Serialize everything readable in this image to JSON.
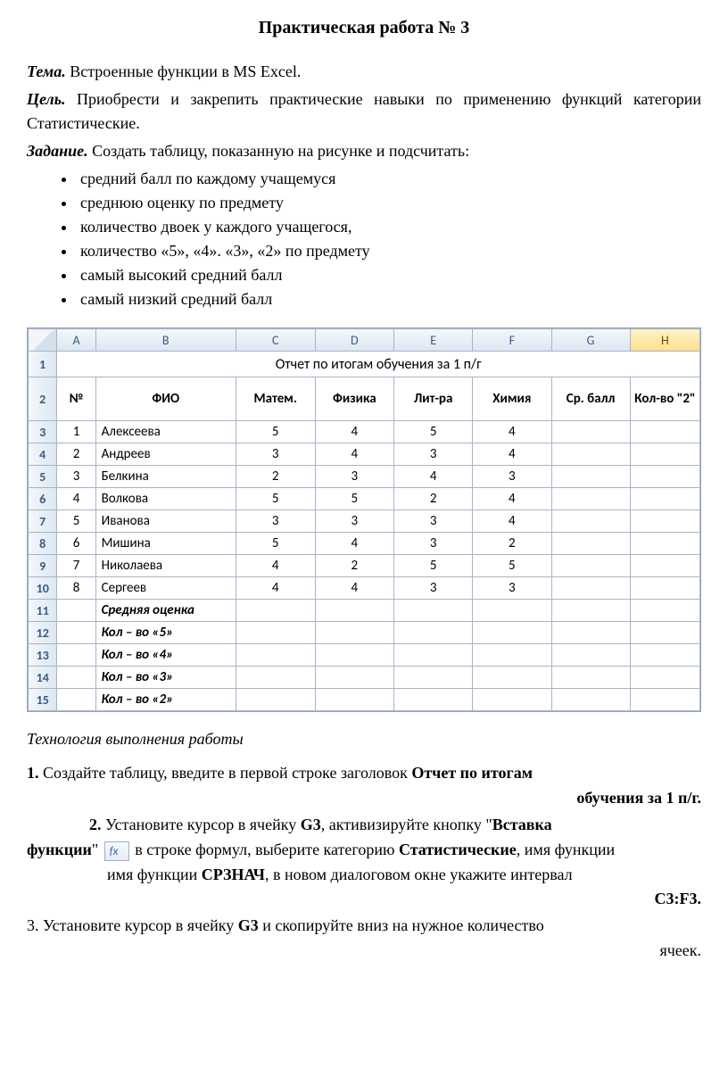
{
  "title": "Практическая работа № 3",
  "topic_label": "Тема.",
  "topic_text": "Встроенные функции в MS Excel.",
  "goal_label": "Цель.",
  "goal_text": "Приобрести и закрепить практические навыки по применению функций категории Статистические.",
  "task_label": "Задание.",
  "task_text": "Создать таблицу, показанную на рисунке и подсчитать:",
  "bullets": [
    "средний балл по каждому учащемуся",
    "среднюю оценку по предмету",
    "количество двоек у каждого учащегося,",
    "количество «5», «4». «3», «2» по предмету",
    "самый высокий средний балл",
    "самый низкий средний балл"
  ],
  "excel": {
    "columns": [
      "A",
      "B",
      "C",
      "D",
      "E",
      "F",
      "G",
      "H"
    ],
    "selected_col": "H",
    "row_numbers": [
      "1",
      "2",
      "3",
      "4",
      "5",
      "6",
      "7",
      "8",
      "9",
      "10",
      "11",
      "12",
      "13",
      "14",
      "15"
    ],
    "merged_title": "Отчет по итогам обучения за 1 п/г",
    "headers": [
      "№",
      "ФИО",
      "Матем.",
      "Физика",
      "Лит-ра",
      "Химия",
      "Ср. балл",
      "Кол-во \"2\""
    ],
    "rows": [
      {
        "n": "1",
        "name": "Алексеева",
        "m": "5",
        "p": "4",
        "l": "5",
        "c": "4"
      },
      {
        "n": "2",
        "name": "Андреев",
        "m": "3",
        "p": "4",
        "l": "3",
        "c": "4"
      },
      {
        "n": "3",
        "name": "Белкина",
        "m": "2",
        "p": "3",
        "l": "4",
        "c": "3"
      },
      {
        "n": "4",
        "name": "Волкова",
        "m": "5",
        "p": "5",
        "l": "2",
        "c": "4"
      },
      {
        "n": "5",
        "name": "Иванова",
        "m": "3",
        "p": "3",
        "l": "3",
        "c": "4"
      },
      {
        "n": "6",
        "name": "Мишина",
        "m": "5",
        "p": "4",
        "l": "3",
        "c": "2"
      },
      {
        "n": "7",
        "name": "Николаева",
        "m": "4",
        "p": "2",
        "l": "5",
        "c": "5"
      },
      {
        "n": "8",
        "name": "Сергеев",
        "m": "4",
        "p": "4",
        "l": "3",
        "c": "3"
      }
    ],
    "summary_rows": [
      "Средняя оценка",
      "Кол – во  «5»",
      "Кол – во  «4»",
      "Кол – во  «3»",
      "Кол – во  «2»"
    ]
  },
  "tech_heading": "Технология выполнения работы",
  "step1_num": "1.",
  "step1_a": "Создайте таблицу, введите в первой строке заголовок ",
  "step1_b": "Отчет по итогам",
  "step1_c": "обучения за 1 п/г.",
  "step2_num": "2.",
  "step2_a": "Установите курсор в ячейку ",
  "step2_g3": "G3",
  "step2_b": ", активизируйте кнопку \"",
  "step2_vf": "Вставка",
  "step2_func": "функции",
  "step2_quote": "\"",
  "step2_c": " в строке формул, выберите категорию ",
  "step2_stat": "Статистические",
  "step2_d": ", имя функции ",
  "step2_fn": "СРЗНАЧ",
  "step2_e": ", в новом диалоговом окне укажите интервал",
  "step2_range": "C3:F3.",
  "step3_num": "3.",
  "step3_a": "Установите курсор в ячейку ",
  "step3_g3": "G3",
  "step3_b": " и скопируйте вниз на нужное количество",
  "step3_c": "ячеек."
}
